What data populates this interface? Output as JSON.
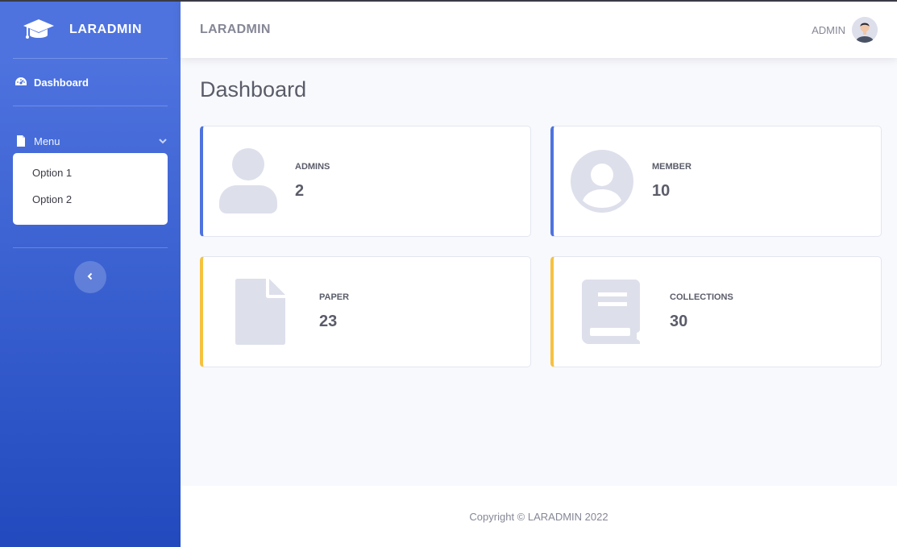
{
  "sidebar": {
    "brand": "LARADMIN",
    "dashboard_label": "Dashboard",
    "menu_label": "Menu",
    "menu_options": [
      "Option 1",
      "Option 2"
    ]
  },
  "topbar": {
    "app_name": "LARADMIN",
    "user_name": "ADMIN"
  },
  "page": {
    "title": "Dashboard"
  },
  "cards": [
    {
      "label": "ADMINS",
      "value": "2",
      "icon": "user-icon",
      "accent": "#4e73df"
    },
    {
      "label": "MEMBER",
      "value": "10",
      "icon": "user-circle-icon",
      "accent": "#4e73df"
    },
    {
      "label": "PAPER",
      "value": "23",
      "icon": "file-icon",
      "accent": "#f6c23e"
    },
    {
      "label": "COLLECTIONS",
      "value": "30",
      "icon": "book-icon",
      "accent": "#f6c23e"
    }
  ],
  "footer": {
    "copyright": "Copyright © LARADMIN 2022"
  },
  "colors": {
    "primary": "#4e73df",
    "warning": "#f6c23e",
    "icon_gray": "#dddfeb"
  }
}
